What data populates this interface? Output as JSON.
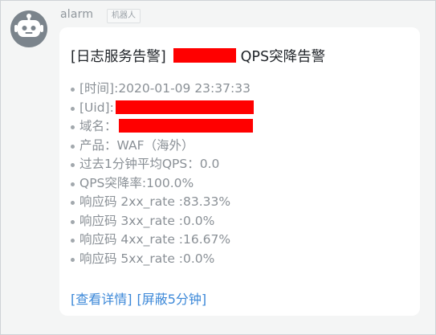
{
  "sender": {
    "name": "alarm",
    "tag": "机器人"
  },
  "message": {
    "title_prefix": "[日志服务告警]",
    "title_suffix": "QPS突降告警",
    "fields": [
      {
        "text": "[时间]:2020-01-09 23:37:33"
      },
      {
        "text": "[Uid]:"
      },
      {
        "text": "域名："
      },
      {
        "text": "产品：WAF（海外）"
      },
      {
        "text": "过去1分钟平均QPS：0.0"
      },
      {
        "text": "QPS突降率:100.0%"
      },
      {
        "text": "响应码 2xx_rate :83.33%"
      },
      {
        "text": "响应码 3xx_rate :0.0%"
      },
      {
        "text": "响应码 4xx_rate :16.67%"
      },
      {
        "text": "响应码 5xx_rate :0.0%"
      }
    ],
    "actions": {
      "details": "[查看详情]",
      "mute": "[屏蔽5分钟]"
    }
  },
  "colors": {
    "redaction": "#ff0000",
    "link": "#3c88d8",
    "avatar": "#7b848c"
  },
  "icons": {
    "avatar": "robot-icon"
  }
}
